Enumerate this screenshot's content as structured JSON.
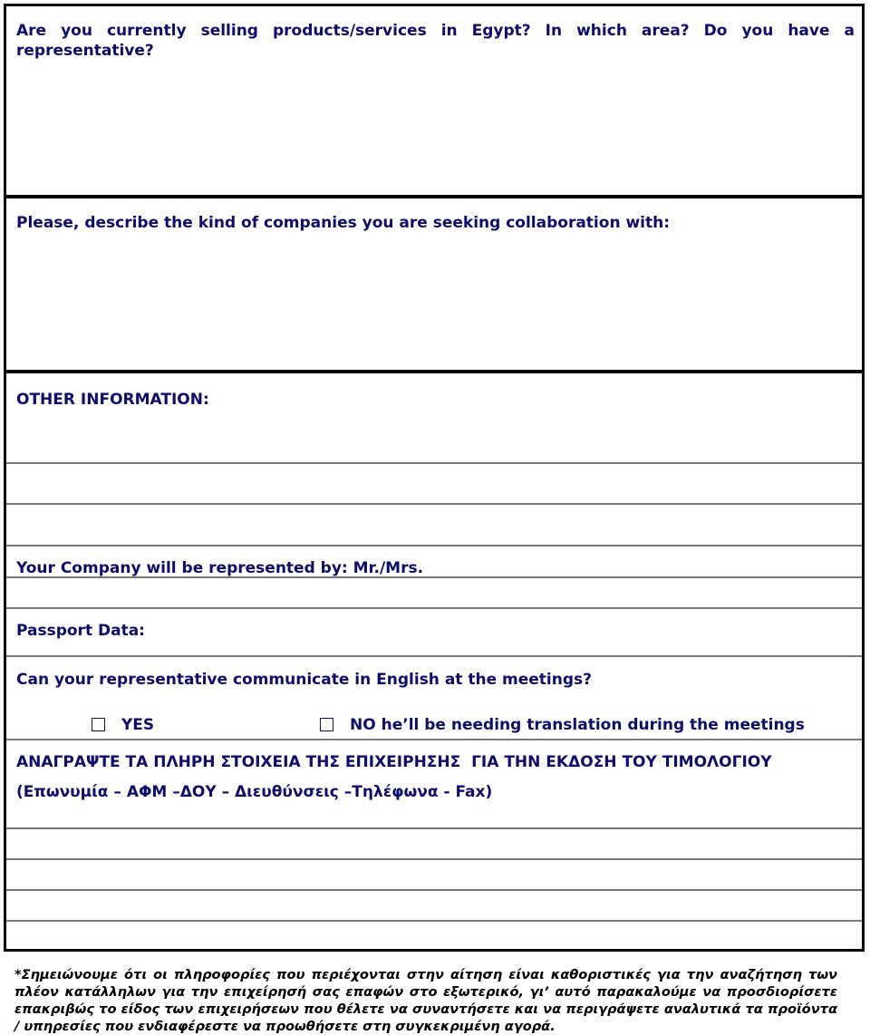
{
  "form": {
    "selling_question": "Are you currently selling products/services in Egypt? In which area? Do you have a representative?",
    "collaboration_prompt": "Please, describe the kind of companies you are seeking collaboration with:",
    "other_information_label": "OTHER INFORMATION:",
    "represented_by_label": "Your Company will be represented by: Mr./Mrs.",
    "passport_label": "Passport Data:",
    "english_question": "Can your representative communicate in English at the meetings?",
    "options": [
      {
        "label": "YES",
        "checked": false
      },
      {
        "label": "NO he’ll be needing translation during the meetings",
        "checked": false
      }
    ],
    "invoice_header": "ΑΝΑΓΡΑΨΤΕ ΤΑ ΠΛΗΡΗ ΣΤΟΙΧΕΙΑ ΤΗΣ ΕΠΙΧΕΙΡΗΣΗΣ  ΓΙΑ ΤΗΝ ΕΚΔΟΣΗ ΤΟΥ ΤΙΜΟΛΟΓΙΟΥ",
    "invoice_fields": "(Επωνυμία – ΑΦΜ –ΔΟΥ – Διευθύνσεις –Τηλέφωνα - Fax)"
  },
  "footnote": "*Σημειώνουμε ότι οι πληροφορίες που περιέχονται στην αίτηση είναι καθοριστικές για την αναζήτηση των πλέον κατάλληλων για την επιχείρησή σας επαφών στο εξωτερικό, γι’ αυτό παρακαλούμε να προσδιορίσετε επακριβώς το είδος των επιχειρήσεων που θέλετε να συναντήσετε και να περιγράψετε αναλυτικά τα προϊόντα / υπηρεσίες που ενδιαφέρεστε να προωθήσετε στη συγκεκριμένη αγορά.",
  "colors": {
    "label_text": "#0d0d6b",
    "border": "#000000",
    "rule": "#777777"
  }
}
